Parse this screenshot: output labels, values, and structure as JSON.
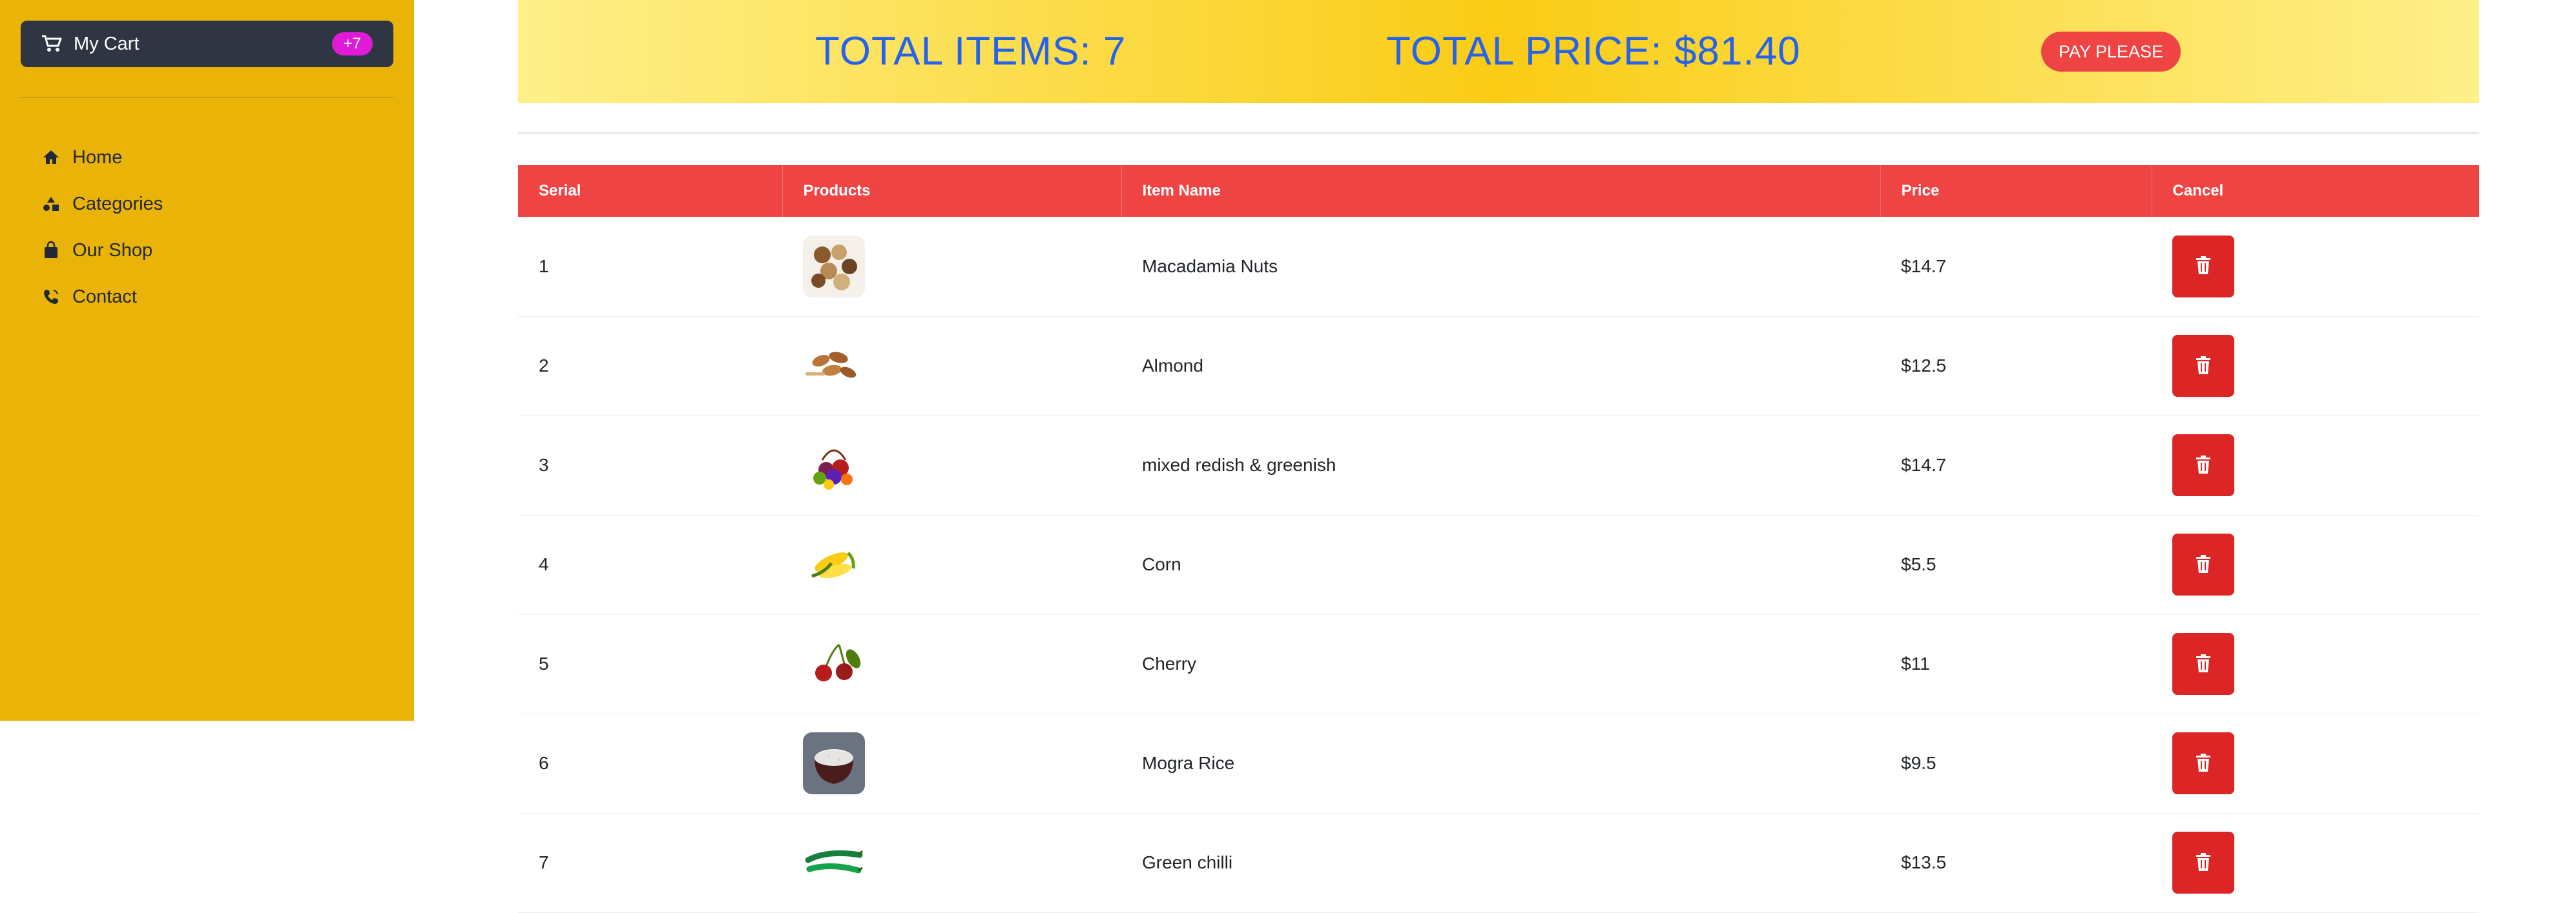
{
  "sidebar": {
    "cart": {
      "label": "My Cart",
      "badge": "+7",
      "icon": "cart-icon"
    },
    "nav": [
      {
        "label": "Home",
        "icon": "home-icon"
      },
      {
        "label": "Categories",
        "icon": "categories-icon"
      },
      {
        "label": "Our Shop",
        "icon": "shop-icon"
      },
      {
        "label": "Contact",
        "icon": "phone-icon"
      }
    ]
  },
  "summary": {
    "total_items": "TOTAL ITEMS: 7",
    "total_price": "TOTAL PRICE: $81.40",
    "pay_label": "PAY PLEASE"
  },
  "table": {
    "headers": [
      "Serial",
      "Products",
      "Item Name",
      "Price",
      "Cancel"
    ],
    "rows": [
      {
        "serial": "1",
        "name": "Macadamia Nuts",
        "price": "$14.7",
        "image": "macadamia-nuts-image"
      },
      {
        "serial": "2",
        "name": "Almond",
        "price": "$12.5",
        "image": "almond-image"
      },
      {
        "serial": "3",
        "name": "mixed redish & greenish",
        "price": "$14.7",
        "image": "mixed-vegetables-image"
      },
      {
        "serial": "4",
        "name": "Corn",
        "price": "$5.5",
        "image": "corn-image"
      },
      {
        "serial": "5",
        "name": "Cherry",
        "price": "$11",
        "image": "cherry-image"
      },
      {
        "serial": "6",
        "name": "Mogra Rice",
        "price": "$9.5",
        "image": "rice-image"
      },
      {
        "serial": "7",
        "name": "Green chilli",
        "price": "$13.5",
        "image": "green-chilli-image"
      }
    ]
  },
  "colors": {
    "sidebar_bg": "#eab308",
    "cart_button_bg": "#2f3542",
    "badge_bg": "#e11ad7",
    "accent_red": "#ef4444",
    "delete_red": "#dc2626",
    "summary_text": "#2563eb"
  }
}
